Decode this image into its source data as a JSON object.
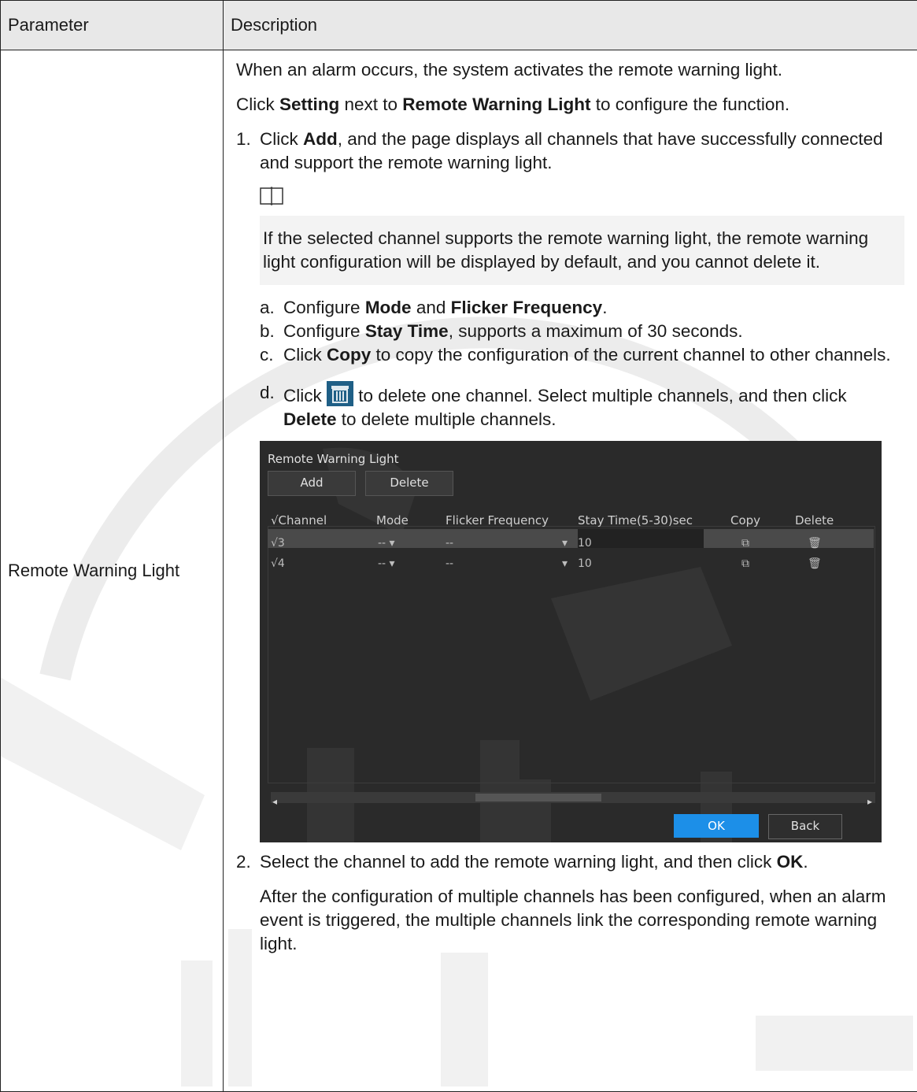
{
  "table": {
    "header": {
      "parameter": "Parameter",
      "description": "Description"
    },
    "row": {
      "parameter": "Remote Warning Light",
      "intro": "When an alarm occurs, the system activates the remote warning light.",
      "setting_line": {
        "t1": "Click ",
        "b1": "Setting",
        "t2": "  next to ",
        "b2": "Remote Warning Light",
        "t3": " to configure the function."
      },
      "step1": {
        "num": "1.",
        "t1": "Click ",
        "b1": "Add",
        "t2": ", and the page displays all channels that have successfully connected and support the remote warning light."
      },
      "note": "If the selected channel supports the remote warning light, the remote warning light configuration will be displayed by default, and you cannot delete it.",
      "sub_a": {
        "num": "a.",
        "t1": "Configure ",
        "b1": "Mode",
        "t2": "  and ",
        "b2": "Flicker Frequency",
        "t3": "."
      },
      "sub_b": {
        "num": "b.",
        "t1": "Configure ",
        "b1": "Stay Time",
        "t2": ", supports a maximum of 30 seconds."
      },
      "sub_c": {
        "num": "c.",
        "t1": "Click ",
        "b1": "Copy",
        "t2": "  to copy the configuration of the current channel to other channels."
      },
      "sub_d": {
        "num": "d.",
        "t1": "Click ",
        "t2": " to delete one channel. Select multiple channels, and then click ",
        "b1": "Delete",
        "t3": "  to delete multiple channels."
      },
      "step2": {
        "num": "2.",
        "t1": "Select the channel to add the remote warning light, and then click ",
        "b1": "OK",
        "t2": "."
      },
      "closing": "After the configuration of multiple channels has been configured, when an alarm event is triggered, the multiple channels link the corresponding remote warning light."
    }
  },
  "dialog": {
    "title": "Remote Warning Light",
    "add_label": "Add",
    "delete_label": "Delete",
    "columns": [
      "√Channel",
      "Mode",
      "Flicker Frequency",
      "Stay Time(5-30)sec",
      "Copy",
      "Delete"
    ],
    "rows": [
      {
        "check": "√",
        "channel": "3",
        "mode": "--",
        "flicker": "--",
        "stay": "10"
      },
      {
        "check": "√",
        "channel": "4",
        "mode": "--",
        "flicker": "--",
        "stay": "10"
      }
    ],
    "ok_label": "OK",
    "back_label": "Back",
    "colors": {
      "background": "#2a2a2a",
      "ok": "#1c8fe8"
    }
  }
}
